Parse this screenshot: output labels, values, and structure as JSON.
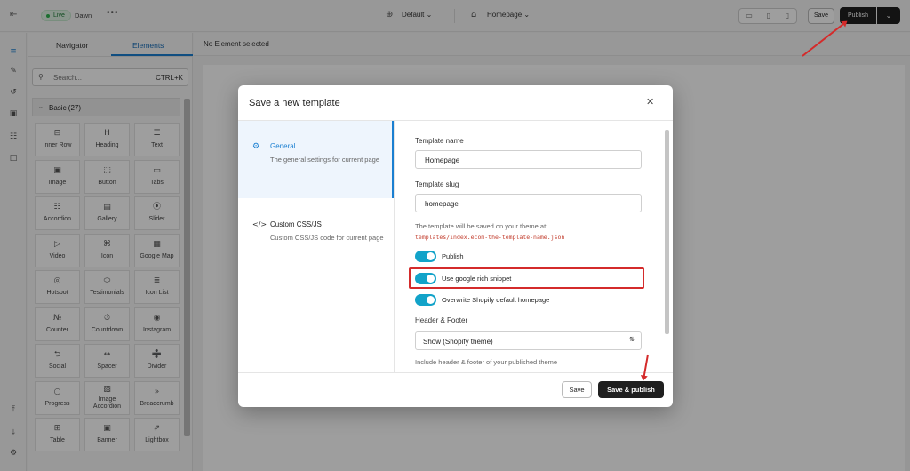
{
  "topbar": {
    "live_label": "Live",
    "theme_name": "Dawn",
    "more_label": "•••",
    "template_selector": "Default",
    "page_selector": "Homepage",
    "save_label": "Save",
    "publish_label": "Publish"
  },
  "panel": {
    "tab_navigator": "Navigator",
    "tab_elements": "Elements",
    "search_placeholder": "Search...",
    "search_shortcut": "CTRL+K",
    "category_label": "Basic (27)",
    "elements": [
      {
        "label": "Inner Row",
        "icon": "⊟"
      },
      {
        "label": "Heading",
        "icon": "H"
      },
      {
        "label": "Text",
        "icon": "☰"
      },
      {
        "label": "Image",
        "icon": "▣"
      },
      {
        "label": "Button",
        "icon": "⬚"
      },
      {
        "label": "Tabs",
        "icon": "▭"
      },
      {
        "label": "Accordion",
        "icon": "☷"
      },
      {
        "label": "Gallery",
        "icon": "▤"
      },
      {
        "label": "Slider",
        "icon": "⦿"
      },
      {
        "label": "Video",
        "icon": "▷"
      },
      {
        "label": "Icon",
        "icon": "⌘"
      },
      {
        "label": "Google Map",
        "icon": "▦"
      },
      {
        "label": "Hotspot",
        "icon": "◎"
      },
      {
        "label": "Testimonials",
        "icon": "⬭"
      },
      {
        "label": "Icon List",
        "icon": "≣"
      },
      {
        "label": "Counter",
        "icon": "№"
      },
      {
        "label": "Countdown",
        "icon": "⏱"
      },
      {
        "label": "Instagram",
        "icon": "◉"
      },
      {
        "label": "Social",
        "icon": "⮌"
      },
      {
        "label": "Spacer",
        "icon": "↔"
      },
      {
        "label": "Divider",
        "icon": "➗"
      },
      {
        "label": "Progress",
        "icon": "○"
      },
      {
        "label": "Image Accordion",
        "icon": "▧"
      },
      {
        "label": "Breadcrumb",
        "icon": "»"
      },
      {
        "label": "Table",
        "icon": "⊞"
      },
      {
        "label": "Banner",
        "icon": "▣"
      },
      {
        "label": "Lightbox",
        "icon": "⇗"
      }
    ]
  },
  "canvas": {
    "status": "No Element selected"
  },
  "modal": {
    "title": "Save a new template",
    "close_label": "✕",
    "sidebar": [
      {
        "icon": "⚙",
        "title": "General",
        "description": "The general settings for current page"
      },
      {
        "icon": "</>",
        "title": "Custom CSS/JS",
        "description": "Custom CSS/JS code for current page"
      }
    ],
    "template_name_label": "Template name",
    "template_name_value": "Homepage",
    "template_slug_label": "Template slug",
    "template_slug_value": "homepage",
    "saved_note": "The template will be saved on your theme at:",
    "saved_path": "templates/index.ecom-the-template-name.json",
    "toggles": [
      {
        "label": "Publish",
        "on": true
      },
      {
        "label": "Use google rich snippet",
        "on": true
      },
      {
        "label": "Overwrite Shopify default homepage",
        "on": true
      }
    ],
    "header_footer_label": "Header & Footer",
    "header_footer_value": "Show (Shopify theme)",
    "header_footer_note": "Include header & footer of your published theme",
    "save_label": "Save",
    "save_publish_label": "Save & publish"
  },
  "colors": {
    "accent": "#1a7fd1",
    "toggle_on": "#12a3c9",
    "highlight_red": "#d42b2b",
    "primary_button": "#1f1f1f"
  }
}
